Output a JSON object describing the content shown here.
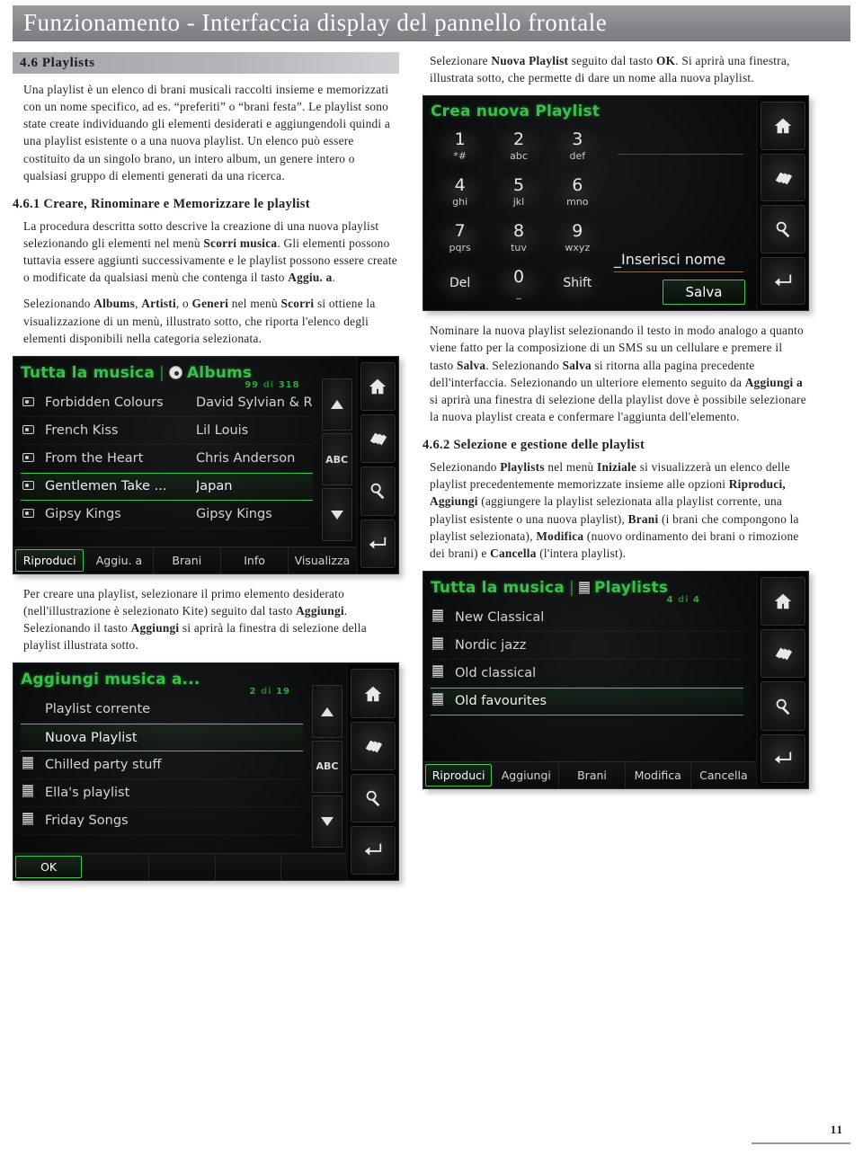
{
  "banner": {
    "title": "Funzionamento - Interfaccia display del pannello frontale"
  },
  "section": {
    "number_title": "4.6  Playlists"
  },
  "left": {
    "intro_p1": "Una playlist è un elenco di brani musicali raccolti insieme e memorizzati con un nome specifico, ad es. “preferiti” o “brani festa”. Le playlist sono state create individuando gli elementi desiderati e aggiungendoli quindi a una playlist esistente o a una nuova playlist. Un elenco può essere costituito da un singolo brano, un intero album, un genere intero o qualsiasi gruppo di elementi generati da una ricerca.",
    "sub_461": "4.6.1 Creare, Rinominare e Memorizzare le playlist",
    "p2_a": "La procedura descritta sotto descrive la creazione di una nuova playlist selezionando gli elementi nel menù ",
    "p2_b1": "Scorri musica",
    "p2_c": ". Gli elementi possono tuttavia essere aggiunti successivamente e le playlist possono essere create o modificate da qualsiasi menù che contenga il tasto ",
    "p2_b2": "Aggiu. a",
    "p2_d": ".",
    "p3_a": "Selezionando ",
    "p3_b1": "Albums",
    "p3_b_sep1": ", ",
    "p3_b2": "Artisti",
    "p3_b_sep2": ", o ",
    "p3_b3": "Generi",
    "p3_c": " nel menù ",
    "p3_b4": "Scorri",
    "p3_d": " si ottiene la visualizzazione di un menù, illustrato sotto, che riporta l'elenco degli elementi disponibili nella categoria selezionata.",
    "p4_a": "Per creare una playlist, selezionare il primo elemento desiderato (nell'illustrazione è selezionato Kite) seguito dal tasto ",
    "p4_b1": "Aggiungi",
    "p4_c": ". Selezionando il tasto ",
    "p4_b2": "Aggiungi",
    "p4_d": " si aprirà la finestra di selezione della playlist illustrata sotto."
  },
  "right": {
    "p1_a": "Selezionare ",
    "p1_b1": "Nuova Playlist",
    "p1_c": " seguito dal tasto ",
    "p1_b2": "OK",
    "p1_d": ". Si aprirà una finestra, illustrata sotto, che permette di dare un nome alla nuova playlist.",
    "p2_a": "Nominare la nuova playlist selezionando il testo in modo analogo a quanto viene fatto per la composizione di un SMS su un cellulare e premere il tasto ",
    "p2_b1": "Salva",
    "p2_c": ". Selezionando ",
    "p2_b2": "Salva",
    "p2_d": " si ritorna alla pagina precedente dell'interfaccia. Selezionando un ulteriore elemento seguito da ",
    "p2_b3": "Aggiungi a",
    "p2_e": " si aprirà una finestra di selezione della playlist dove è possibile selezionare la nuova playlist creata e confermare l'aggiunta dell'elemento.",
    "sub_462": "4.6.2 Selezione e gestione delle playlist",
    "p3_a": "Selezionando ",
    "p3_b1": "Playlists",
    "p3_c": " nel menù ",
    "p3_b2": "Iniziale",
    "p3_d": " si visualizzerà un elenco delle playlist precedentemente memorizzate insieme alle opzioni ",
    "p3_b3": "Riproduci, Aggiungi",
    "p3_e": " (aggiungere la playlist selezionata alla playlist corrente, una playlist esistente o una nuova playlist), ",
    "p3_b4": "Brani",
    "p3_f": " (i brani che compongono la playlist selezionata), ",
    "p3_b5": "Modifica",
    "p3_g": " (nuovo ordinamento dei brani o rimozione dei brani) e ",
    "p3_b6": "Cancella",
    "p3_h": " (l'intera playlist)."
  },
  "shot_albums": {
    "title_left": "Tutta la musica",
    "separator": "|",
    "title_right": "Albums",
    "counter_current": "99",
    "counter_of": "di",
    "counter_total": "318",
    "rows": [
      {
        "icon": "cd-icon",
        "name": "Forbidden Colours",
        "artist": "David Sylvian & R",
        "selected": false
      },
      {
        "icon": "cd-icon",
        "name": "French Kiss",
        "artist": "Lil Louis",
        "selected": false
      },
      {
        "icon": "cd-icon",
        "name": "From the Heart",
        "artist": "Chris Anderson",
        "selected": false
      },
      {
        "icon": "cd-icon",
        "name": "Gentlemen Take ...",
        "artist": "Japan",
        "selected": true
      },
      {
        "icon": "cd-icon",
        "name": "Gipsy Kings",
        "artist": "Gipsy Kings",
        "selected": false
      }
    ],
    "scroll": {
      "up": "▲",
      "abc": "ABC",
      "down": "▼"
    },
    "softkeys": [
      {
        "label": "Riproduci",
        "selected": true
      },
      {
        "label": "Aggiu. a",
        "selected": false
      },
      {
        "label": "Brani",
        "selected": false
      },
      {
        "label": "Info",
        "selected": false
      },
      {
        "label": "Visualizza",
        "selected": false
      }
    ]
  },
  "shot_add": {
    "title_left": "Aggiungi musica a...",
    "counter_current": "2",
    "counter_of": "di",
    "counter_total": "19",
    "rows": [
      {
        "icon": "none",
        "name": "Playlist corrente",
        "selected": false
      },
      {
        "icon": "none",
        "name": "Nuova Playlist",
        "selected": true
      },
      {
        "icon": "list-icon",
        "name": "Chilled party stuff",
        "selected": false
      },
      {
        "icon": "list-icon",
        "name": "Ella's playlist",
        "selected": false
      },
      {
        "icon": "list-icon",
        "name": "Friday Songs",
        "selected": false
      }
    ],
    "scroll": {
      "up": "▲",
      "abc": "ABC",
      "down": "▼"
    },
    "softkeys": [
      {
        "label": "OK",
        "selected": true
      },
      {
        "label": "",
        "selected": false
      },
      {
        "label": "",
        "selected": false
      },
      {
        "label": "",
        "selected": false
      },
      {
        "label": "",
        "selected": false
      }
    ]
  },
  "shot_keypad": {
    "title": "Crea nuova Playlist",
    "keys": [
      {
        "big": "1",
        "sub": "*#"
      },
      {
        "big": "2",
        "sub": "abc"
      },
      {
        "big": "3",
        "sub": "def"
      },
      {
        "big": "4",
        "sub": "ghi"
      },
      {
        "big": "5",
        "sub": "jkl"
      },
      {
        "big": "6",
        "sub": "mno"
      },
      {
        "big": "7",
        "sub": "pqrs"
      },
      {
        "big": "8",
        "sub": "tuv"
      },
      {
        "big": "9",
        "sub": "wxyz"
      },
      {
        "big": "Del",
        "sub": ""
      },
      {
        "big": "0",
        "sub": "_"
      },
      {
        "big": "Shift",
        "sub": ""
      }
    ],
    "input_value": "_Inserisci nome",
    "save_label": "Salva"
  },
  "shot_playlists": {
    "title_left": "Tutta la musica",
    "separator": "|",
    "title_right": "Playlists",
    "counter_current": "4",
    "counter_of": "di",
    "counter_total": "4",
    "rows": [
      {
        "icon": "list-icon",
        "name": "New Classical",
        "selected": false
      },
      {
        "icon": "list-icon",
        "name": "Nordic jazz",
        "selected": false
      },
      {
        "icon": "list-icon",
        "name": "Old classical",
        "selected": false
      },
      {
        "icon": "list-icon",
        "name": "Old favourites",
        "selected": true
      }
    ],
    "softkeys": [
      {
        "label": "Riproduci",
        "selected": true
      },
      {
        "label": "Aggiungi",
        "selected": false
      },
      {
        "label": "Brani",
        "selected": false
      },
      {
        "label": "Modifica",
        "selected": false
      },
      {
        "label": "Cancella",
        "selected": false
      }
    ]
  },
  "side_icons": [
    "home-icon",
    "cards-icon",
    "search-icon",
    "enter-icon"
  ],
  "footer": {
    "page_number": "11"
  },
  "colors": {
    "accent_green": "#37c14a",
    "banner_gray": "#8e8e92",
    "screen_black": "#0b0c0b"
  }
}
